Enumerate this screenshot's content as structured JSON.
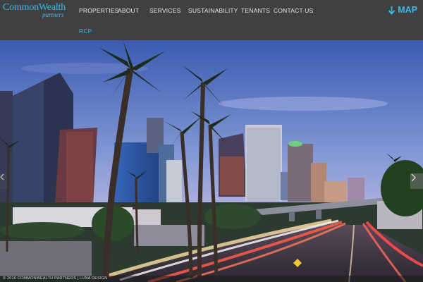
{
  "brand": {
    "name_main": "CommonWealth",
    "name_sub": "partners"
  },
  "nav": {
    "items": [
      {
        "label": "PROPERTIES",
        "active": false
      },
      {
        "label": "ABOUT",
        "active": false
      },
      {
        "label": "SERVICES",
        "active": false
      },
      {
        "label": "SUSTAINABILITY",
        "active": false
      },
      {
        "label": "TENANTS",
        "active": false
      },
      {
        "label": "CONTACT US",
        "active": false
      },
      {
        "label": "RCP",
        "active": true
      }
    ],
    "map_label": "MAP",
    "map_icon": "arrow-down-icon"
  },
  "hero": {
    "scene": "downtown city skyline at dusk with palm trees and freeway light trails",
    "next_icon": "chevron-right-icon",
    "prev_icon": "chevron-left-icon"
  },
  "footer": {
    "text": "© 2016 COMMONWEALTH PARTNERS | LUNA DESIGN"
  },
  "colors": {
    "accent": "#41b8e4",
    "header_bg": "#3e4042",
    "nav_text": "#e8e8e8"
  }
}
